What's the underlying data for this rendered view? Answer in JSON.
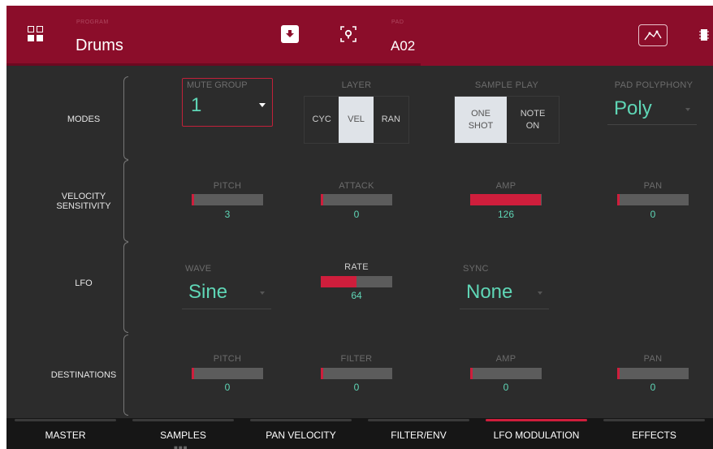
{
  "header": {
    "program_label": "PROGRAM",
    "program_value": "Drums",
    "pad_label": "PAD",
    "pad_value": "A02"
  },
  "rows": {
    "modes": "MODES",
    "velocity": "VELOCITY\nSENSITIVITY",
    "lfo": "LFO",
    "destinations": "DESTINATIONS"
  },
  "modes": {
    "mute_group": {
      "label": "MUTE GROUP",
      "value": "1"
    },
    "layer": {
      "label": "LAYER",
      "options": [
        "CYC",
        "VEL",
        "RAN"
      ],
      "selected": "VEL"
    },
    "sample_play": {
      "label": "SAMPLE PLAY",
      "options": [
        "ONE\nSHOT",
        "NOTE\nON"
      ],
      "selected": "ONE SHOT"
    },
    "pad_polyphony": {
      "label": "PAD POLYPHONY",
      "value": "Poly"
    }
  },
  "velocity": {
    "pitch": {
      "label": "PITCH",
      "value": 3
    },
    "attack": {
      "label": "ATTACK",
      "value": 0
    },
    "amp": {
      "label": "AMP",
      "value": 126
    },
    "pan": {
      "label": "PAN",
      "value": 0
    }
  },
  "lfo": {
    "wave": {
      "label": "WAVE",
      "value": "Sine"
    },
    "rate": {
      "label": "RATE",
      "value": 64
    },
    "sync": {
      "label": "SYNC",
      "value": "None"
    }
  },
  "destinations": {
    "pitch": {
      "label": "PITCH",
      "value": 0
    },
    "filter": {
      "label": "FILTER",
      "value": 0
    },
    "amp": {
      "label": "AMP",
      "value": 0
    },
    "pan": {
      "label": "PAN",
      "value": 0
    }
  },
  "tabs": [
    "MASTER",
    "SAMPLES",
    "PAN VELOCITY",
    "FILTER/ENV",
    "LFO MODULATION",
    "EFFECTS"
  ],
  "active_tab": "LFO MODULATION",
  "slider_max": 127,
  "colors": {
    "header": "#8b0d2a",
    "accent": "#cf1e3c",
    "value": "#5fd6b6"
  },
  "icons": [
    "grid-menu-icon",
    "download-icon",
    "locate-icon",
    "envelope-icon",
    "chip-icon"
  ]
}
